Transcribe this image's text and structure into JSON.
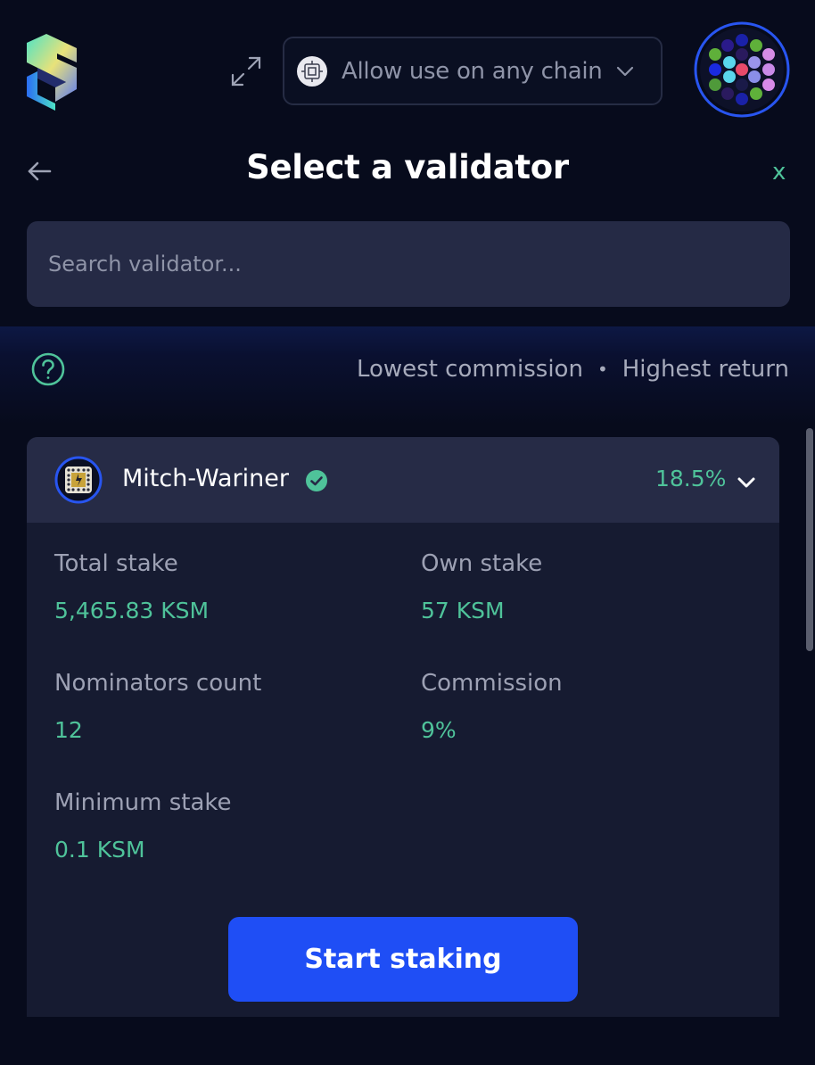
{
  "header": {
    "chain_selector_label": "Allow use on any chain"
  },
  "page": {
    "title": "Select a validator",
    "close_label": "x"
  },
  "search": {
    "placeholder": "Search validator..."
  },
  "sort": {
    "options": [
      "Lowest commission",
      "Highest return"
    ],
    "separator": "•"
  },
  "validator": {
    "name": "Mitch-Wariner",
    "return": "18.5%",
    "stats": {
      "total_stake_label": "Total stake",
      "total_stake_value": "5,465.83 KSM",
      "own_stake_label": "Own stake",
      "own_stake_value": "57 KSM",
      "nominators_label": "Nominators count",
      "nominators_value": "12",
      "commission_label": "Commission",
      "commission_value": "9%",
      "min_stake_label": "Minimum stake",
      "min_stake_value": "0.1 KSM"
    },
    "action_label": "Start staking"
  },
  "colors": {
    "background": "#070b1c",
    "accent_green": "#4fc39a",
    "primary_blue": "#1f4ef5",
    "card": "#161b31",
    "card_header": "#262b46",
    "input": "#252a45"
  },
  "icons": {
    "logo": "subwallet-logo-icon",
    "expand": "expand-icon",
    "chain": "chain-icon",
    "avatar": "account-avatar-icon",
    "back": "arrow-left-icon",
    "help": "question-circle-icon",
    "verified": "check-circle-icon",
    "chevron": "chevron-down-icon"
  }
}
